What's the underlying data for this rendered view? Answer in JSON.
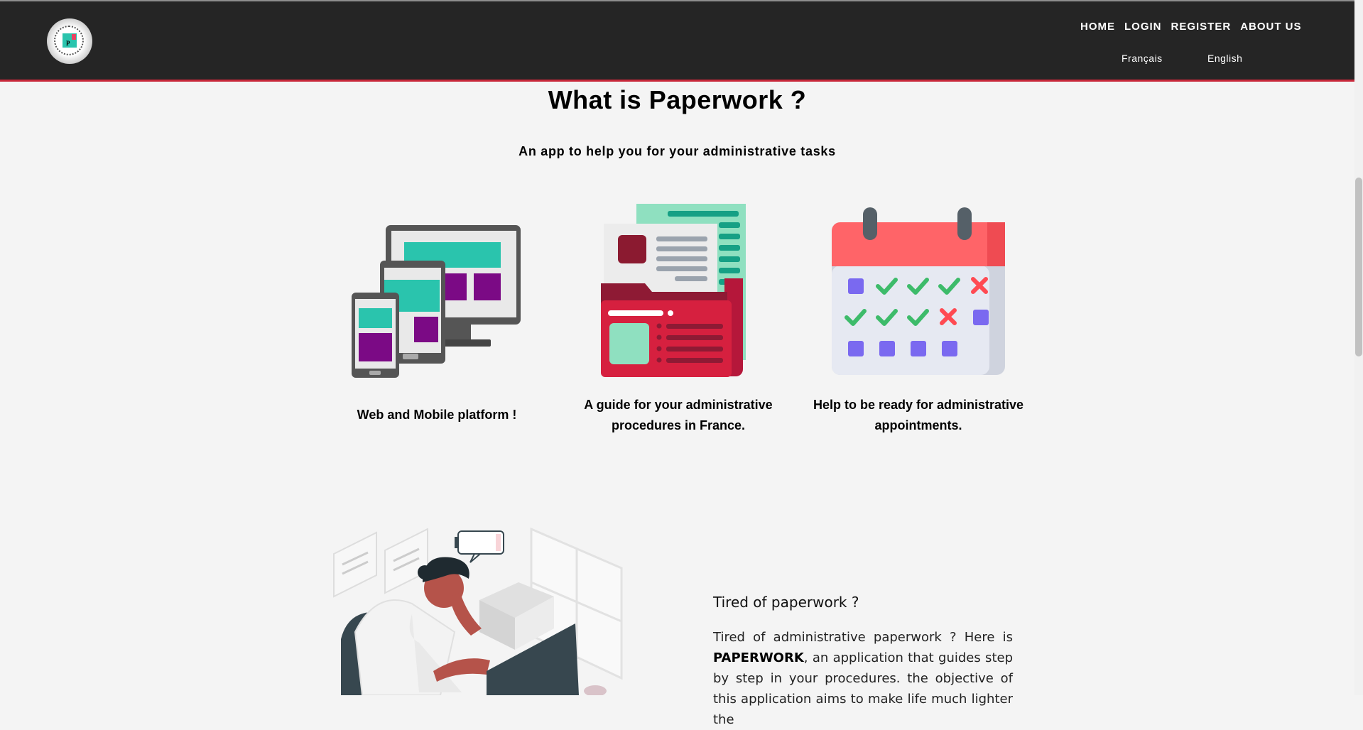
{
  "nav": {
    "links": [
      "HOME",
      "LOGIN",
      "REGISTER",
      "ABOUT US"
    ],
    "languages": [
      "Français",
      "English"
    ]
  },
  "intro": {
    "title": "What is Paperwork ?",
    "subtitle": "An app to help you for your administrative tasks"
  },
  "features": [
    {
      "icon": "devices-icon",
      "caption": "Web and Mobile platform !"
    },
    {
      "icon": "folder-documents-icon",
      "caption": "A guide for your administrative procedures in France."
    },
    {
      "icon": "calendar-icon",
      "caption": "Help to be ready for administrative appointments."
    }
  ],
  "tired": {
    "heading": "Tired of paperwork ?",
    "body_start": "Tired of administrative paperwork ? Here is ",
    "body_bold": "PAPERWORK",
    "body_end": ", an application that guides step by step in your procedures. the objective of this application aims to make life much lighter the"
  },
  "colors": {
    "navbar": "#252525",
    "navbar_border": "#c8283a",
    "background": "#f4f4f4",
    "teal": "#2ac4ad",
    "purple": "#7b0a85",
    "red": "#d6203f",
    "calendar_red": "#ff6468",
    "check_green": "#3dbb6a",
    "square_violet": "#7a69f0"
  }
}
